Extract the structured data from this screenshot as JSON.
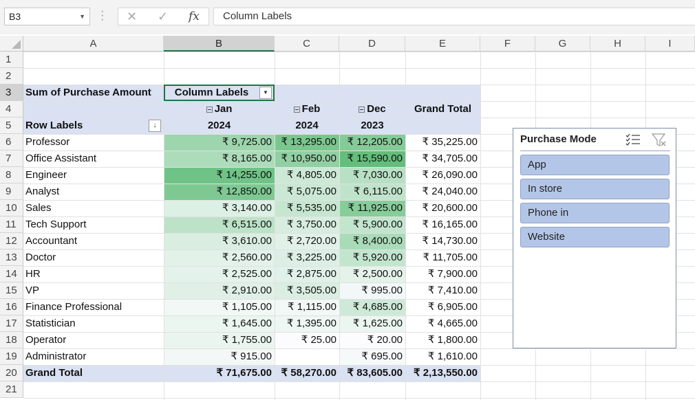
{
  "formula_bar": {
    "name_box": "B3",
    "cancel": "✕",
    "enter": "✓",
    "fx": "fx",
    "content": "Column Labels"
  },
  "columns": [
    "A",
    "B",
    "C",
    "D",
    "E",
    "F",
    "G",
    "H",
    "I"
  ],
  "rows": [
    "1",
    "2",
    "3",
    "4",
    "5",
    "6",
    "7",
    "8",
    "9",
    "10",
    "11",
    "12",
    "13",
    "14",
    "15",
    "16",
    "17",
    "18",
    "19",
    "20",
    "21"
  ],
  "pivot": {
    "sum_label": "Sum of Purchase Amount",
    "column_labels": "Column Labels",
    "row_labels": "Row Labels",
    "months": [
      {
        "name": "Jan",
        "year": "2024"
      },
      {
        "name": "Feb",
        "year": "2024"
      },
      {
        "name": "Dec",
        "year": "2023"
      }
    ],
    "grand_total_header": "Grand Total",
    "rows": [
      {
        "label": "Professor",
        "v": [
          "₹ 9,725.00",
          "₹ 13,295.00",
          "₹ 12,205.00"
        ],
        "t": "₹ 35,225.00"
      },
      {
        "label": "Office Assistant",
        "v": [
          "₹ 8,165.00",
          "₹ 10,950.00",
          "₹ 15,590.00"
        ],
        "t": "₹ 34,705.00"
      },
      {
        "label": "Engineer",
        "v": [
          "₹ 14,255.00",
          "₹ 4,805.00",
          "₹ 7,030.00"
        ],
        "t": "₹ 26,090.00"
      },
      {
        "label": "Analyst",
        "v": [
          "₹ 12,850.00",
          "₹ 5,075.00",
          "₹ 6,115.00"
        ],
        "t": "₹ 24,040.00"
      },
      {
        "label": "Sales",
        "v": [
          "₹ 3,140.00",
          "₹ 5,535.00",
          "₹ 11,925.00"
        ],
        "t": "₹ 20,600.00"
      },
      {
        "label": "Tech Support",
        "v": [
          "₹ 6,515.00",
          "₹ 3,750.00",
          "₹ 5,900.00"
        ],
        "t": "₹ 16,165.00"
      },
      {
        "label": "Accountant",
        "v": [
          "₹ 3,610.00",
          "₹ 2,720.00",
          "₹ 8,400.00"
        ],
        "t": "₹ 14,730.00"
      },
      {
        "label": "Doctor",
        "v": [
          "₹ 2,560.00",
          "₹ 3,225.00",
          "₹ 5,920.00"
        ],
        "t": "₹ 11,705.00"
      },
      {
        "label": "HR",
        "v": [
          "₹ 2,525.00",
          "₹ 2,875.00",
          "₹ 2,500.00"
        ],
        "t": "₹ 7,900.00"
      },
      {
        "label": "VP",
        "v": [
          "₹ 2,910.00",
          "₹ 3,505.00",
          "₹ 995.00"
        ],
        "t": "₹ 7,410.00"
      },
      {
        "label": "Finance Professional",
        "v": [
          "₹ 1,105.00",
          "₹ 1,115.00",
          "₹ 4,685.00"
        ],
        "t": "₹ 6,905.00"
      },
      {
        "label": "Statistician",
        "v": [
          "₹ 1,645.00",
          "₹ 1,395.00",
          "₹ 1,625.00"
        ],
        "t": "₹ 4,665.00"
      },
      {
        "label": "Operator",
        "v": [
          "₹ 1,755.00",
          "₹ 25.00",
          "₹ 20.00"
        ],
        "t": "₹ 1,800.00"
      },
      {
        "label": "Administrator",
        "v": [
          "₹ 915.00",
          "",
          "₹ 695.00"
        ],
        "t": "₹ 1,610.00"
      }
    ],
    "grand_total": {
      "label": "Grand Total",
      "v": [
        "₹ 71,675.00",
        "₹ 58,270.00",
        "₹ 83,605.00"
      ],
      "t": "₹ 2,13,550.00"
    }
  },
  "slicer": {
    "title": "Purchase Mode",
    "items": [
      "App",
      "In store",
      "Phone in",
      "Website"
    ]
  },
  "colors": {
    "accent": "#217346",
    "pivot_band": "#d9e1f2",
    "slicer_item": "#b4c6e7",
    "heat_high": "#63be7b",
    "heat_low": "#fcfcff"
  }
}
